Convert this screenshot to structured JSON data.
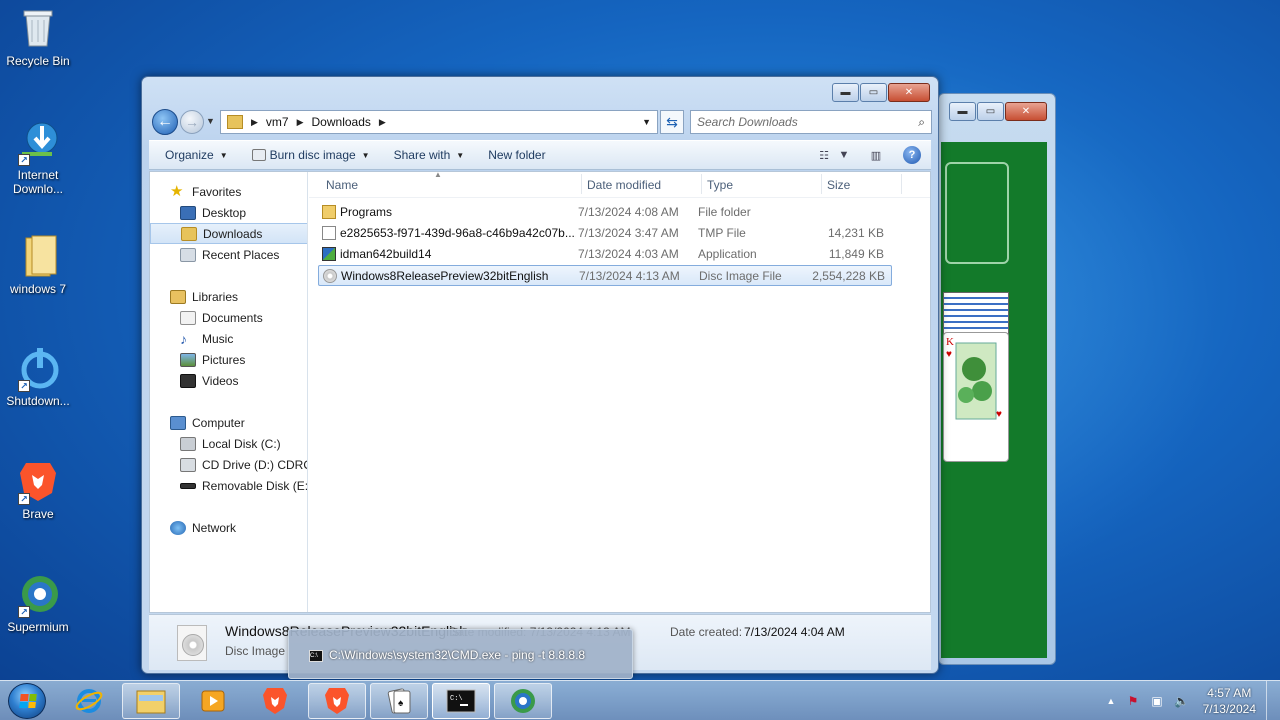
{
  "desktop": {
    "icons": [
      {
        "label": "Recycle Bin",
        "icon": "recycle-bin-icon"
      },
      {
        "label": "Internet Downlo...",
        "icon": "idm-icon"
      },
      {
        "label": "windows 7",
        "icon": "folder-icon"
      },
      {
        "label": "Shutdown...",
        "icon": "power-icon"
      },
      {
        "label": "Brave",
        "icon": "brave-icon"
      },
      {
        "label": "Supermium",
        "icon": "supermium-icon"
      }
    ]
  },
  "explorer": {
    "address": {
      "segments": [
        "vm7",
        "Downloads"
      ]
    },
    "search_placeholder": "Search Downloads",
    "toolbar": {
      "organize": "Organize",
      "burn": "Burn disc image",
      "share": "Share with",
      "new_folder": "New folder"
    },
    "nav": {
      "favorites": "Favorites",
      "desktop": "Desktop",
      "downloads": "Downloads",
      "recent": "Recent Places",
      "libraries": "Libraries",
      "documents": "Documents",
      "music": "Music",
      "pictures": "Pictures",
      "videos": "Videos",
      "computer": "Computer",
      "local_disk": "Local Disk (C:)",
      "cd_drive": "CD Drive (D:) CDROM",
      "removable": "Removable Disk (E:)",
      "network": "Network"
    },
    "columns": {
      "name": "Name",
      "date": "Date modified",
      "type": "Type",
      "size": "Size"
    },
    "files": [
      {
        "name": "Programs",
        "date": "7/13/2024 4:08 AM",
        "type": "File folder",
        "size": "",
        "icon": "folder-icon"
      },
      {
        "name": "e2825653-f971-439d-96a8-c46b9a42c07b....",
        "date": "7/13/2024 3:47 AM",
        "type": "TMP File",
        "size": "14,231 KB",
        "icon": "file-icon"
      },
      {
        "name": "idman642build14",
        "date": "7/13/2024 4:03 AM",
        "type": "Application",
        "size": "11,849 KB",
        "icon": "app-icon"
      },
      {
        "name": "Windows8ReleasePreview32bitEnglish",
        "date": "7/13/2024 4:13 AM",
        "type": "Disc Image File",
        "size": "2,554,228 KB",
        "icon": "disc-image-icon"
      }
    ],
    "details": {
      "name": "Windows8ReleasePreview32bitEnglish",
      "type": "Disc Image",
      "modified": "Date modified: 7/13/2024 4:13 AM",
      "created_label": "Date created:",
      "created_value": "7/13/2024 4:04 AM"
    }
  },
  "thumbnail_tooltip": "C:\\Windows\\system32\\CMD.exe - ping  -t 8.8.8.8",
  "taskbar": {
    "time": "4:57 AM",
    "date": "7/13/2024"
  }
}
